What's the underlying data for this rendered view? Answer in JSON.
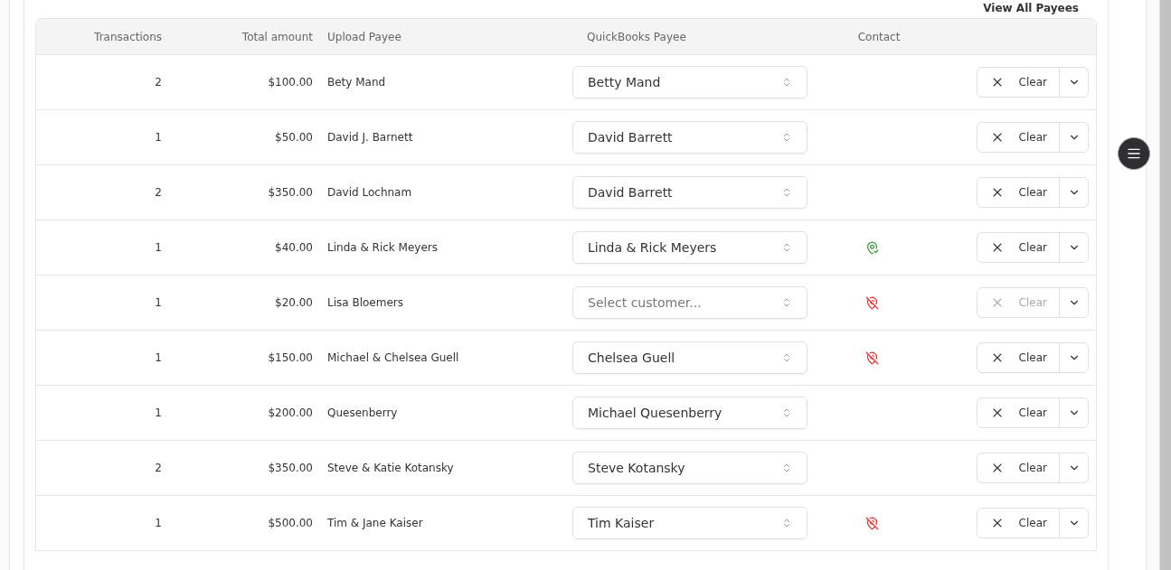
{
  "link": "View All Payees",
  "table": {
    "columns": [
      "Transactions",
      "Total amount",
      "Upload Payee",
      "QuickBooks Payee",
      "Contact"
    ],
    "rows": [
      {
        "transactions": "2",
        "amount": "$100.00",
        "upload_payee": "Bety Mand",
        "payee": {
          "value": "Betty Mand"
        },
        "clear": {
          "label": "Clear",
          "disabled": false
        }
      },
      {
        "transactions": "1",
        "amount": "$50.00",
        "upload_payee": "David J. Barnett",
        "payee": {
          "value": "David Barrett"
        },
        "clear": {
          "label": "Clear",
          "disabled": false
        }
      },
      {
        "transactions": "2",
        "amount": "$350.00",
        "upload_payee": "David Lochnam",
        "payee": {
          "value": "David Barrett"
        },
        "clear": {
          "label": "Clear",
          "disabled": false
        }
      },
      {
        "transactions": "1",
        "amount": "$40.00",
        "upload_payee": "Linda & Rick Meyers",
        "payee": {
          "value": "Linda & Rick Meyers"
        },
        "contact": {
          "kind": "linked"
        },
        "clear": {
          "label": "Clear",
          "disabled": false
        }
      },
      {
        "transactions": "1",
        "amount": "$20.00",
        "upload_payee": "Lisa Bloemers",
        "payee": {
          "placeholder": "Select customer..."
        },
        "contact": {
          "kind": "unlinked"
        },
        "clear": {
          "label": "Clear",
          "disabled": true
        }
      },
      {
        "transactions": "1",
        "amount": "$150.00",
        "upload_payee": "Michael & Chelsea Guell",
        "payee": {
          "value": "Chelsea Guell"
        },
        "contact": {
          "kind": "unlinked"
        },
        "clear": {
          "label": "Clear",
          "disabled": false
        }
      },
      {
        "transactions": "1",
        "amount": "$200.00",
        "upload_payee": "Quesenberry",
        "payee": {
          "value": "Michael Quesenberry"
        },
        "clear": {
          "label": "Clear",
          "disabled": false
        }
      },
      {
        "transactions": "2",
        "amount": "$350.00",
        "upload_payee": "Steve & Katie Kotansky",
        "payee": {
          "value": "Steve Kotansky"
        },
        "clear": {
          "label": "Clear",
          "disabled": false
        }
      },
      {
        "transactions": "1",
        "amount": "$500.00",
        "upload_payee": "Tim & Jane Kaiser",
        "payee": {
          "value": "Tim Kaiser"
        },
        "contact": {
          "kind": "unlinked"
        },
        "clear": {
          "label": "Clear",
          "disabled": false
        }
      }
    ]
  }
}
